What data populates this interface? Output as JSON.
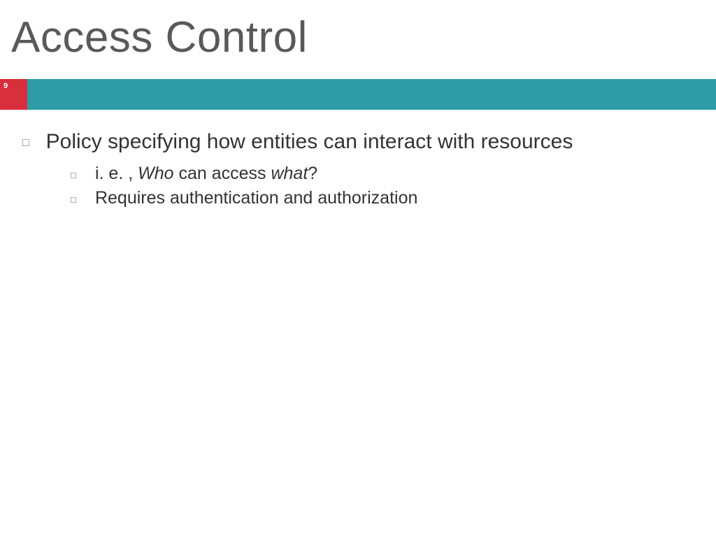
{
  "title": "Access Control",
  "page_number": "9",
  "bullets": {
    "main": "Policy specifying how entities can interact with resources",
    "sub1_pre": "i. e. , ",
    "sub1_who": "Who",
    "sub1_mid": " can access ",
    "sub1_what": "what",
    "sub1_post": "?",
    "sub2": "Requires authentication and authorization"
  }
}
